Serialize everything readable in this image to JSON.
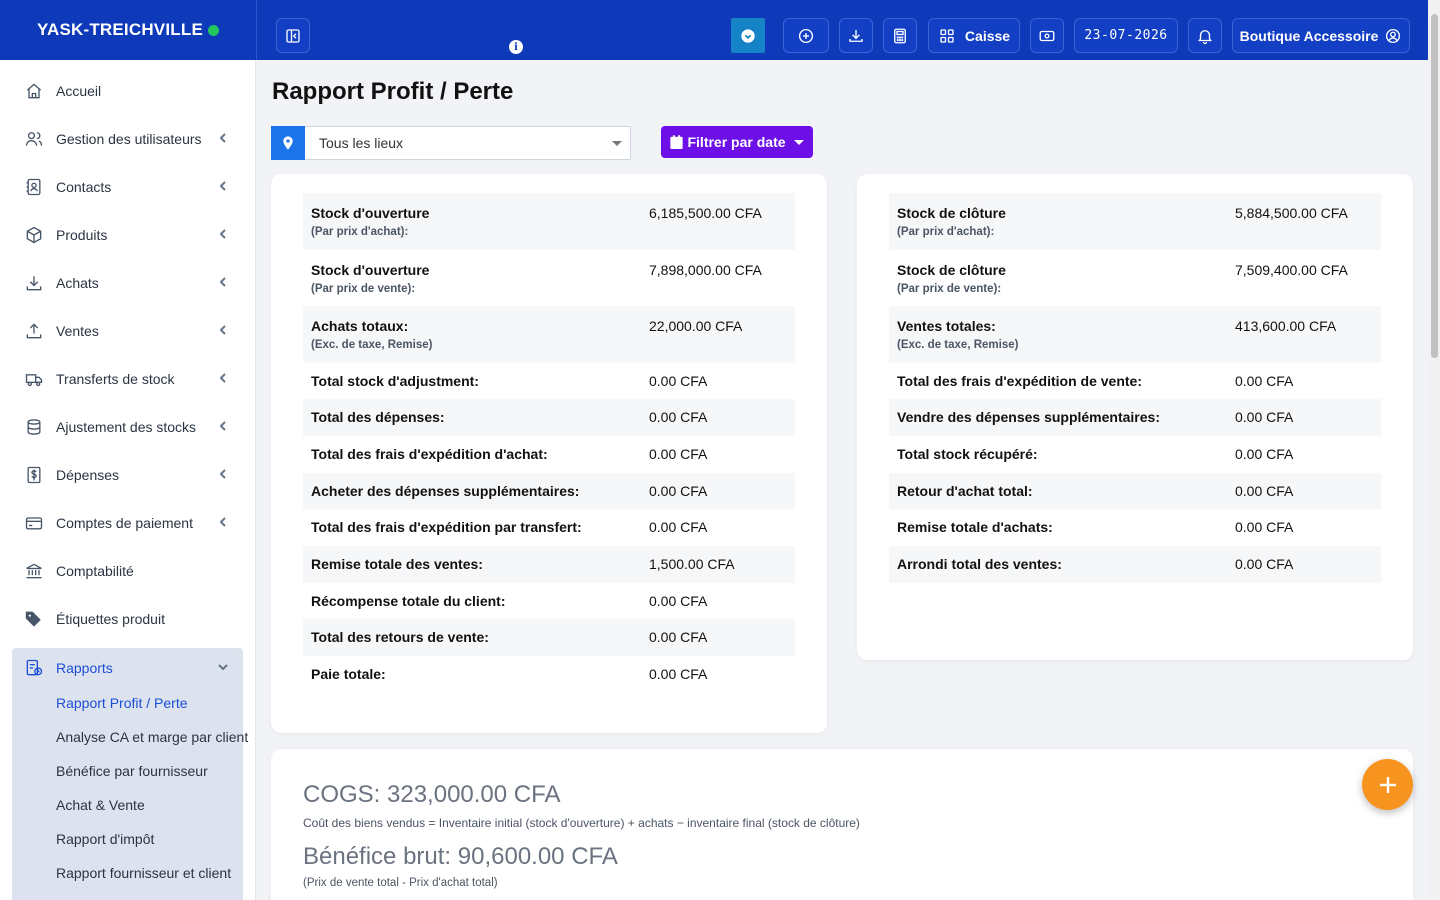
{
  "brand": {
    "name": "YASK-TREICHVILLE"
  },
  "topbar": {
    "cash_register_label": "Caisse",
    "date": "23-07-2026",
    "user_menu_label": "Boutique Accessoire"
  },
  "sidebar": {
    "items": [
      {
        "label": "Accueil"
      },
      {
        "label": "Gestion des utilisateurs"
      },
      {
        "label": "Contacts"
      },
      {
        "label": "Produits"
      },
      {
        "label": "Achats"
      },
      {
        "label": "Ventes"
      },
      {
        "label": "Transferts de stock"
      },
      {
        "label": "Ajustement des stocks"
      },
      {
        "label": "Dépenses"
      },
      {
        "label": "Comptes de paiement"
      },
      {
        "label": "Comptabilité"
      },
      {
        "label": "Étiquettes produit"
      }
    ],
    "reports": {
      "label": "Rapports",
      "sub_items": [
        {
          "label": "Rapport Profit / Perte"
        },
        {
          "label": "Analyse CA et marge par client"
        },
        {
          "label": "Bénéfice par fournisseur"
        },
        {
          "label": "Achat & Vente"
        },
        {
          "label": "Rapport d'impôt"
        },
        {
          "label": "Rapport fournisseur et client"
        }
      ]
    }
  },
  "main": {
    "title": "Rapport Profit / Perte",
    "location_select": {
      "value": "Tous les lieux"
    },
    "filter_button": "Filtrer par date",
    "left_rows": [
      {
        "label": "Stock d'ouverture",
        "sub": "(Par prix d'achat):",
        "value": "6,185,500.00 CFA"
      },
      {
        "label": "Stock d'ouverture",
        "sub": "(Par prix de vente):",
        "value": "7,898,000.00 CFA"
      },
      {
        "label": "Achats totaux:",
        "sub": "(Exc. de taxe, Remise)",
        "value": "22,000.00 CFA"
      },
      {
        "label": "Total stock d'adjustment:",
        "value": "0.00 CFA"
      },
      {
        "label": "Total des dépenses:",
        "value": "0.00 CFA"
      },
      {
        "label": "Total des frais d'expédition d'achat:",
        "value": "0.00 CFA"
      },
      {
        "label": "Acheter des dépenses supplémentaires:",
        "value": "0.00 CFA"
      },
      {
        "label": "Total des frais d'expédition par transfert:",
        "value": "0.00 CFA"
      },
      {
        "label": "Remise totale des ventes:",
        "value": "1,500.00 CFA"
      },
      {
        "label": "Récompense totale du client:",
        "value": "0.00 CFA"
      },
      {
        "label": "Total des retours de vente:",
        "value": "0.00 CFA"
      },
      {
        "label": "Paie totale:",
        "value": "0.00 CFA"
      }
    ],
    "right_rows": [
      {
        "label": "Stock de clôture",
        "sub": "(Par prix d'achat):",
        "value": "5,884,500.00 CFA"
      },
      {
        "label": "Stock de clôture",
        "sub": "(Par prix de vente):",
        "value": "7,509,400.00 CFA"
      },
      {
        "label": "Ventes totales:",
        "sub": "(Exc. de taxe, Remise)",
        "value": "413,600.00 CFA"
      },
      {
        "label": "Total des frais d'expédition de vente:",
        "value": "0.00 CFA"
      },
      {
        "label": "Vendre des dépenses supplémentaires:",
        "value": "0.00 CFA"
      },
      {
        "label": "Total stock récupéré:",
        "value": "0.00 CFA"
      },
      {
        "label": "Retour d'achat total:",
        "value": "0.00 CFA"
      },
      {
        "label": "Remise totale d'achats:",
        "value": "0.00 CFA"
      },
      {
        "label": "Arrondi total des ventes:",
        "value": "0.00 CFA"
      }
    ],
    "summary": {
      "cogs": "COGS: 323,000.00 CFA",
      "cogs_desc": "Coût des biens vendus = Inventaire initial (stock d'ouverture) + achats − inventaire final (stock de clôture)",
      "gross_profit": "Bénéfice brut: 90,600.00 CFA",
      "gross_profit_desc": "(Prix de vente total - Prix d'achat total)"
    }
  },
  "colors": {
    "primary": "#0e39b8",
    "filter_button": "#6d10e8",
    "location_icon": "#1d74e8",
    "fab": "#f79420",
    "active_link": "#1d4ed8",
    "status_online": "#22c55e"
  }
}
